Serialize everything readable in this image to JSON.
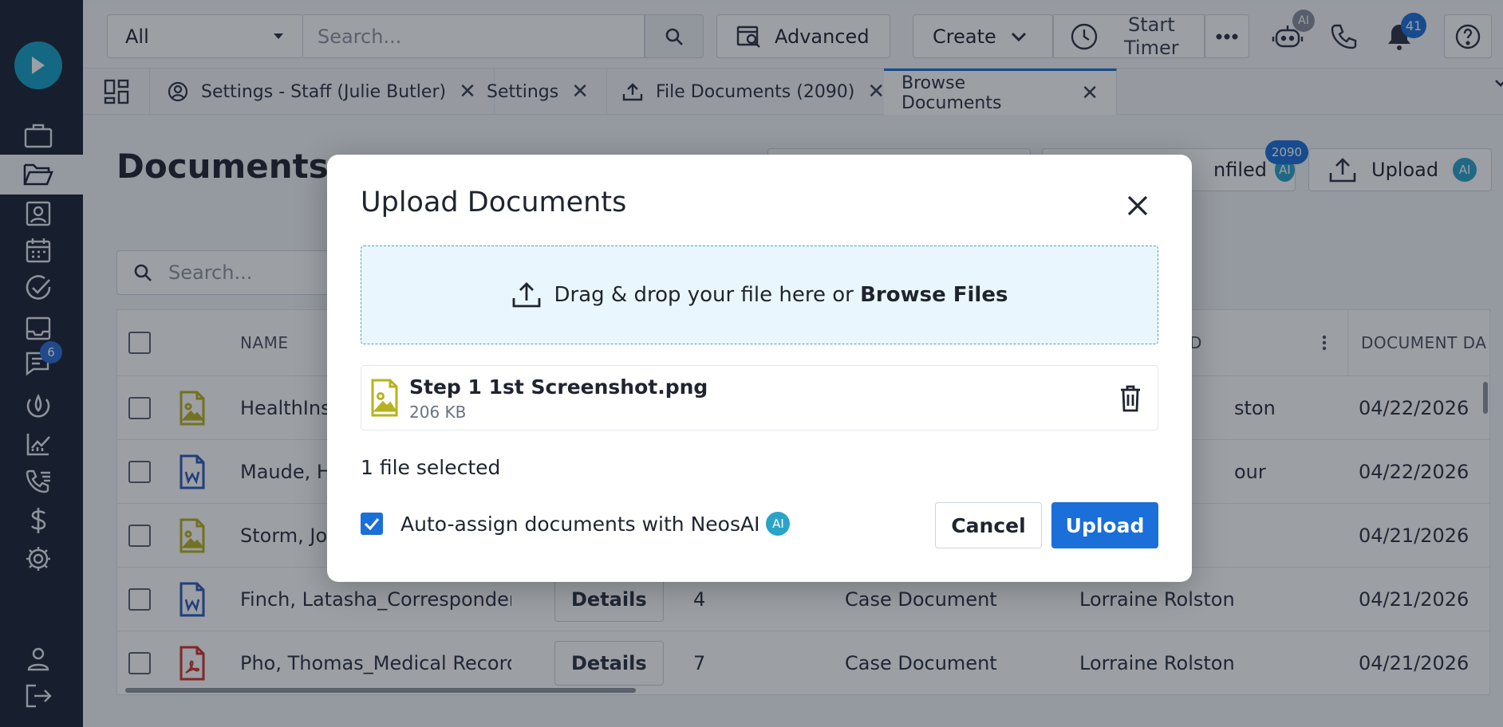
{
  "topbar": {
    "scope_select": "All",
    "search_placeholder": "Search...",
    "advanced_label": "Advanced",
    "create_label": "Create",
    "timer_label_line1": "Start",
    "timer_label_line2": "Timer",
    "ai_badge": "AI",
    "notifications_count": "41"
  },
  "tabs": [
    {
      "label": "Settings - Staff (Julie Butler)",
      "icon": "user-circle-icon"
    },
    {
      "label": "Settings",
      "icon": null
    },
    {
      "label": "File Documents (2090)",
      "icon": "upload-icon"
    },
    {
      "label": "Browse Documents",
      "icon": null,
      "active": true
    }
  ],
  "sidebar": {
    "messages_badge": "6"
  },
  "page": {
    "title": "Documents",
    "unfiled_label": "nfiled",
    "unfiled_count": "2090",
    "upload_label": "Upload",
    "ai_chip": "AI",
    "search_placeholder": "Search..."
  },
  "table": {
    "headers": {
      "name": "NAME",
      "assigned": "D",
      "document_date": "DOCUMENT DA"
    },
    "rows": [
      {
        "name": "HealthIns",
        "assigned": "ston",
        "date": "04/22/2026",
        "filetype": "image"
      },
      {
        "name": "Maude, H",
        "assigned": "our",
        "date": "04/22/2026",
        "filetype": "word"
      },
      {
        "name": "Storm, Joh",
        "assigned": "",
        "date": "04/21/2026",
        "filetype": "image"
      },
      {
        "name": "Finch, Latasha_Corresponden",
        "details": "Details",
        "count": "4",
        "category": "Case Document",
        "assigned": "Lorraine Rolston",
        "date": "04/21/2026",
        "filetype": "word"
      },
      {
        "name": "Pho, Thomas_Medical Record",
        "details": "Details",
        "count": "7",
        "category": "Case Document",
        "assigned": "Lorraine Rolston",
        "date": "04/21/2026",
        "filetype": "pdf"
      }
    ]
  },
  "modal": {
    "title": "Upload Documents",
    "dropzone_text": "Drag & drop your file here or ",
    "dropzone_link": "Browse Files",
    "file": {
      "name": "Step 1 1st Screenshot.png",
      "size": "206 KB"
    },
    "selected_count": "1 file selected",
    "auto_assign_label": "Auto-assign documents with NeosAI",
    "auto_assign_checked": true,
    "ai_chip": "AI",
    "cancel_label": "Cancel",
    "upload_label": "Upload"
  },
  "colors": {
    "primary": "#1a6fd8",
    "rail": "#1a2233",
    "ai_chip": "#2aa3c8",
    "dropzone_bg": "#eaf6fd",
    "image_file": "#b7b21e",
    "word_file": "#2b5bb8",
    "pdf_file": "#d0312d"
  }
}
